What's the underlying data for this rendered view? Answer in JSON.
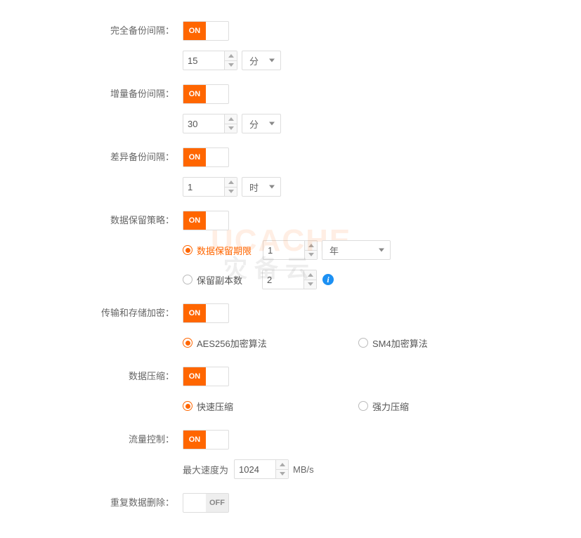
{
  "watermark": {
    "line1": "UCACHE",
    "line2": "灾备云"
  },
  "toggle_text": {
    "on": "ON",
    "off": "OFF"
  },
  "full_backup": {
    "label": "完全备份间隔：",
    "on": true,
    "value": "15",
    "unit": "分"
  },
  "incr_backup": {
    "label": "增量备份间隔：",
    "on": true,
    "value": "30",
    "unit": "分"
  },
  "diff_backup": {
    "label": "差异备份间隔：",
    "on": true,
    "value": "1",
    "unit": "时"
  },
  "retention": {
    "label": "数据保留策略：",
    "on": true,
    "opt1": {
      "label": "数据保留期限",
      "checked": true,
      "value": "1",
      "unit": "年"
    },
    "opt2": {
      "label": "保留副本数",
      "checked": false,
      "value": "2"
    }
  },
  "encryption": {
    "label": "传输和存储加密：",
    "on": true,
    "opt1": {
      "label": "AES256加密算法",
      "checked": true
    },
    "opt2": {
      "label": "SM4加密算法",
      "checked": false
    }
  },
  "compression": {
    "label": "数据压缩：",
    "on": true,
    "opt1": {
      "label": "快速压缩",
      "checked": true
    },
    "opt2": {
      "label": "强力压缩",
      "checked": false
    }
  },
  "traffic": {
    "label": "流量控制：",
    "on": true,
    "max_speed_label": "最大速度为",
    "value": "1024",
    "unit": "MB/s"
  },
  "dedup": {
    "label": "重复数据删除：",
    "on": false
  }
}
